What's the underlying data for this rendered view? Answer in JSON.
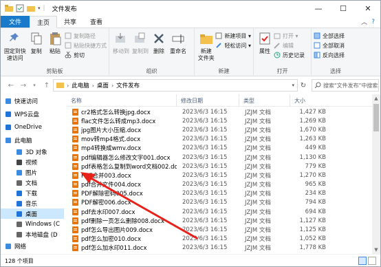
{
  "window": {
    "title": "文件发布",
    "minimize": "—",
    "maximize": "☐",
    "close": "✕"
  },
  "tabs": {
    "file": "文件",
    "home": "主页",
    "share": "共享",
    "view": "查看"
  },
  "ribbon": {
    "clipboard": {
      "group": "剪贴板",
      "pin": "固定到快\n速访问",
      "copy": "复制",
      "paste": "粘贴",
      "copy_path": "复制路径",
      "paste_shortcut": "粘贴快捷方式",
      "cut": "剪切"
    },
    "organize": {
      "group": "组织",
      "move_to": "移动到",
      "copy_to": "复制到",
      "delete": "删除",
      "rename": "重命名"
    },
    "new": {
      "group": "新建",
      "new_folder": "新建\n文件夹",
      "new_item": "新建项目 ▾",
      "easy_access": "轻松访问 ▾"
    },
    "open": {
      "group": "打开",
      "properties": "属性",
      "open": "打开 ▾",
      "edit": "编辑",
      "history": "历史记录"
    },
    "select": {
      "group": "选择",
      "select_all": "全部选择",
      "select_none": "全部取消",
      "invert": "反向选择"
    }
  },
  "address": {
    "crumbs": [
      "此电脑",
      "桌面",
      "文件发布"
    ],
    "search_placeholder": "搜索\"文件发布\"中搜索"
  },
  "nav_pane": {
    "items": [
      {
        "label": "快速访问",
        "icon": "star-icon",
        "color": "#3c8be0"
      },
      {
        "label": "WPS云盘",
        "icon": "cloud-icon",
        "color": "#1e74d8"
      },
      {
        "label": "OneDrive",
        "icon": "onedrive-icon",
        "color": "#1e74d8"
      },
      {
        "label": "此电脑",
        "icon": "computer-icon",
        "color": "#3c8be0"
      },
      {
        "label": "3D 对象",
        "icon": "cube-icon",
        "color": "#3c8be0",
        "sub": true
      },
      {
        "label": "视频",
        "icon": "video-icon",
        "color": "#444",
        "sub": true
      },
      {
        "label": "图片",
        "icon": "picture-icon",
        "color": "#3c8be0",
        "sub": true
      },
      {
        "label": "文档",
        "icon": "document-icon",
        "color": "#666",
        "sub": true
      },
      {
        "label": "下载",
        "icon": "download-icon",
        "color": "#1e74d8",
        "sub": true
      },
      {
        "label": "音乐",
        "icon": "music-icon",
        "color": "#1e74d8",
        "sub": true
      },
      {
        "label": "桌面",
        "icon": "desktop-icon",
        "color": "#1e74d8",
        "sub": true,
        "selected": true
      },
      {
        "label": "Windows (C",
        "icon": "drive-icon",
        "color": "#666",
        "sub": true
      },
      {
        "label": "本地磁盘 (D",
        "icon": "drive-icon",
        "color": "#666",
        "sub": true
      },
      {
        "label": "网络",
        "icon": "network-icon",
        "color": "#3c8be0"
      }
    ]
  },
  "columns": {
    "name": "名称",
    "date": "修改日期",
    "type": "类型",
    "size": "大小"
  },
  "files": [
    {
      "name": "cr2格式怎么转换jpg.docx",
      "date": "2023/6/3 16:15",
      "type": "JZJM 文档",
      "size": "1,427 KB"
    },
    {
      "name": "flac文件怎么转成mp3.docx",
      "date": "2023/6/3 16:15",
      "type": "JZJM 文档",
      "size": "1,269 KB"
    },
    {
      "name": "jpg图片大小压缩.docx",
      "date": "2023/6/3 16:15",
      "type": "JZJM 文档",
      "size": "1,670 KB"
    },
    {
      "name": "mov转mp4格式.docx",
      "date": "2023/6/3 16:15",
      "type": "JZJM 文档",
      "size": "1,263 KB"
    },
    {
      "name": "mp4转换成wmv.docx",
      "date": "2023/6/3 16:15",
      "type": "JZJM 文档",
      "size": "449 KB"
    },
    {
      "name": "pdf编辑器怎么修改文字001.docx",
      "date": "2023/6/3 16:15",
      "type": "JZJM 文档",
      "size": "1,130 KB"
    },
    {
      "name": "pdf表格怎么复制到word文档002.docx",
      "date": "2023/6/3 16:15",
      "type": "JZJM 文档",
      "size": "779 KB"
    },
    {
      "name": "PDF合并003.docx",
      "date": "2023/6/3 16:15",
      "type": "JZJM 文档",
      "size": "1,270 KB"
    },
    {
      "name": "pdf合并文件004.docx",
      "date": "2023/6/3 16:15",
      "type": "JZJM 文档",
      "size": "965 KB"
    },
    {
      "name": "PDF解除密码005.docx",
      "date": "2023/6/3 16:15",
      "type": "JZJM 文档",
      "size": "234 KB"
    },
    {
      "name": "PDF解密006.docx",
      "date": "2023/6/3 16:15",
      "type": "JZJM 文档",
      "size": "794 KB"
    },
    {
      "name": "pdf去水印007.docx",
      "date": "2023/6/3 16:15",
      "type": "JZJM 文档",
      "size": "694 KB"
    },
    {
      "name": "pdf删除一页怎么删除008.docx",
      "date": "2023/6/3 16:15",
      "type": "JZJM 文档",
      "size": "1,127 KB"
    },
    {
      "name": "pdf怎么导出图片009.docx",
      "date": "2023/6/3 16:15",
      "type": "JZJM 文档",
      "size": "1,125 KB"
    },
    {
      "name": "pdf怎么加密010.docx",
      "date": "2023/6/3 16:15",
      "type": "JZJM 文档",
      "size": "1,052 KB"
    },
    {
      "name": "pdf怎么加水印011.docx",
      "date": "2023/6/3 16:15",
      "type": "JZJM 文档",
      "size": "1,778 KB"
    }
  ],
  "status": {
    "count": "128 个项目"
  },
  "colors": {
    "accent": "#1979ca",
    "selection": "#cce8ff",
    "doc_icon": "#e8740a",
    "annotation_arrow": "#e8221a"
  }
}
